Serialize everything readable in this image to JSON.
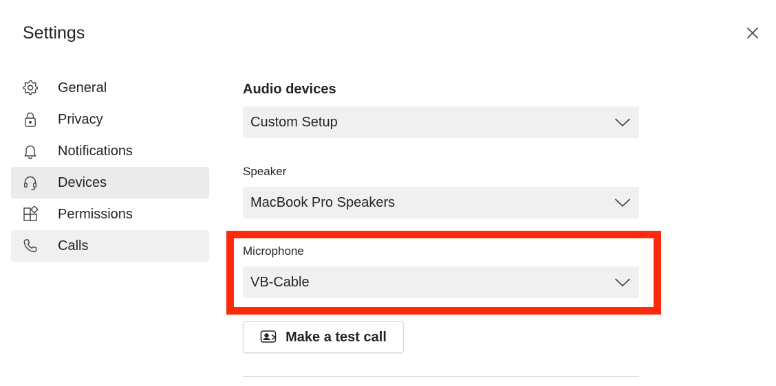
{
  "window": {
    "title": "Settings"
  },
  "sidebar": {
    "items": [
      {
        "label": "General",
        "icon": "gear-icon",
        "active": false
      },
      {
        "label": "Privacy",
        "icon": "lock-icon",
        "active": false
      },
      {
        "label": "Notifications",
        "icon": "bell-icon",
        "active": false
      },
      {
        "label": "Devices",
        "icon": "headset-icon",
        "active": true
      },
      {
        "label": "Permissions",
        "icon": "apps-icon",
        "active": false
      },
      {
        "label": "Calls",
        "icon": "phone-icon",
        "active": false
      }
    ]
  },
  "devices": {
    "section_title": "Audio devices",
    "audio_device": {
      "value": "Custom Setup"
    },
    "speaker": {
      "label": "Speaker",
      "value": "MacBook Pro Speakers"
    },
    "microphone": {
      "label": "Microphone",
      "value": "VB-Cable"
    },
    "test_call_label": "Make a test call"
  },
  "colors": {
    "highlight": "#ff2a0c",
    "select_bg": "#f0f0f0",
    "active_nav_bg": "#ebebeb"
  }
}
